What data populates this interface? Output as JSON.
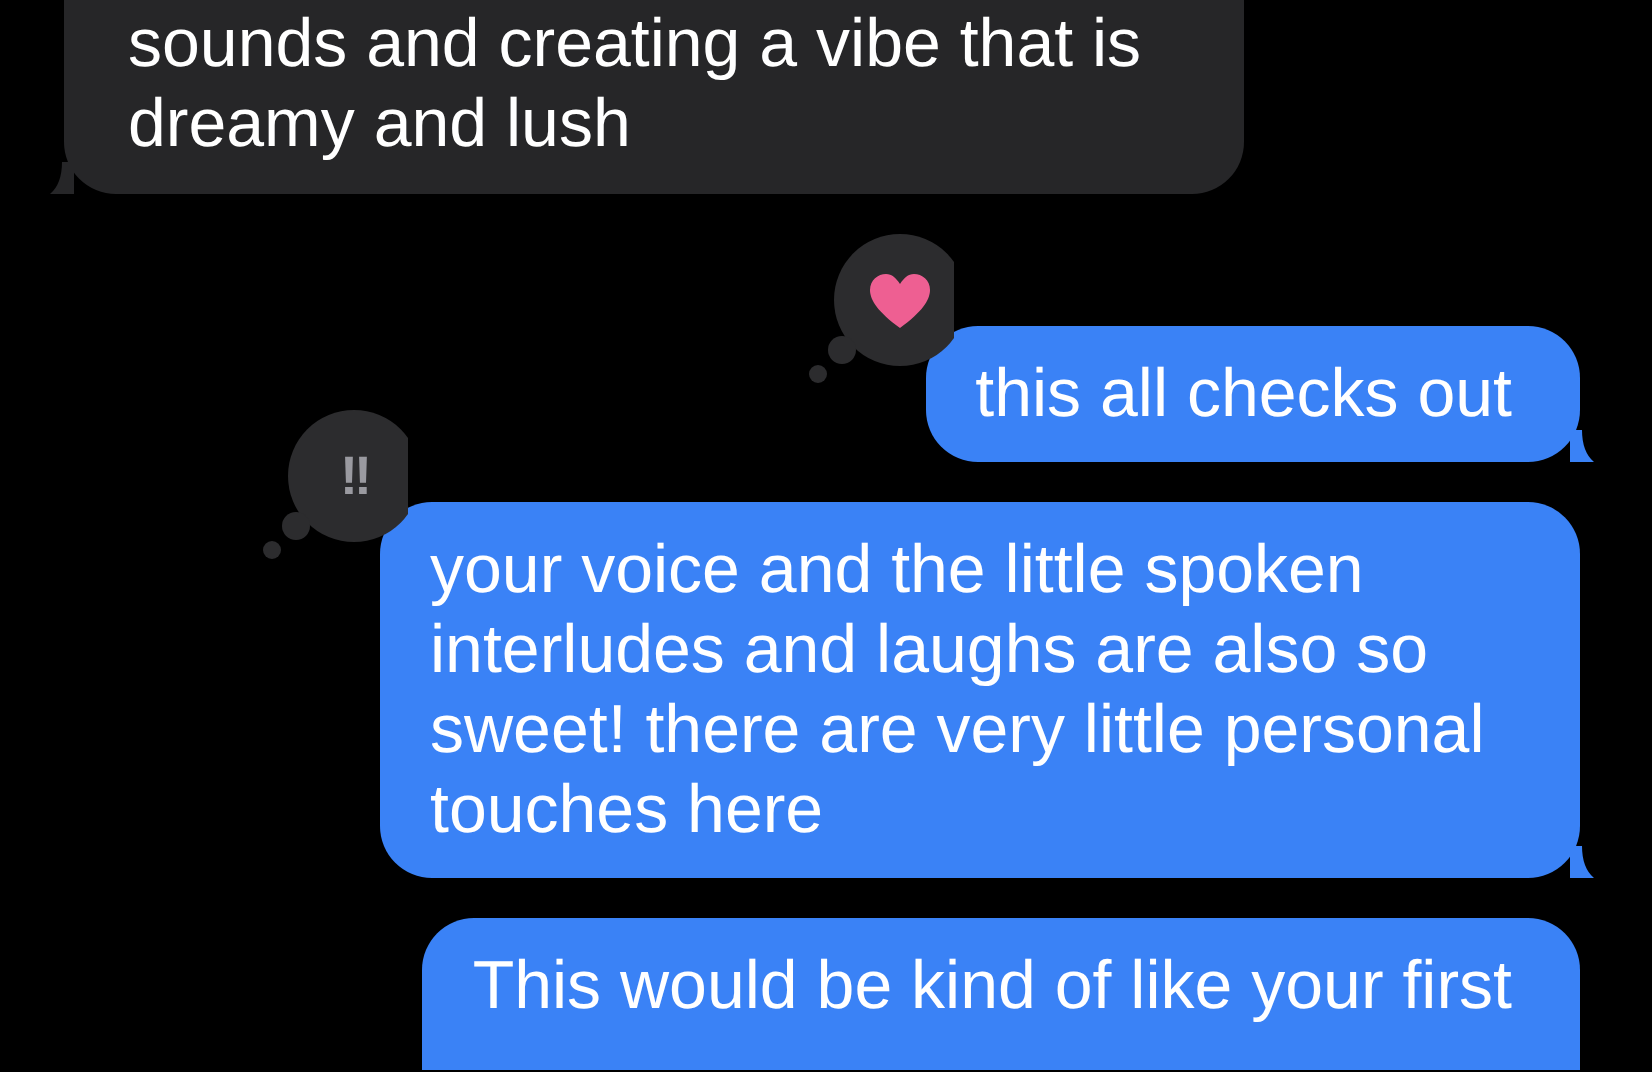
{
  "messages": [
    {
      "kind": "received",
      "text": "sounds and creating a vibe that is dreamy and lush"
    },
    {
      "kind": "sent",
      "text": "this all checks out",
      "reaction": {
        "kind": "heart"
      }
    },
    {
      "kind": "sent",
      "text": "your voice and the little spoken interludes and laughs are also so sweet! there are very little personal touches here",
      "reaction": {
        "kind": "text",
        "text": "!!"
      }
    },
    {
      "kind": "sent",
      "text": "This would be kind of like your first",
      "cut": true
    }
  ]
}
